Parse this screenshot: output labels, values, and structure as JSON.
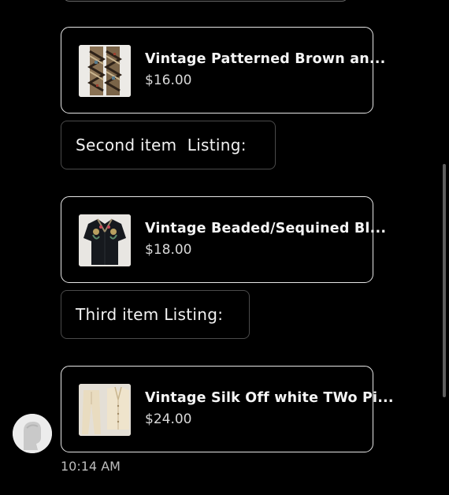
{
  "listings": [
    {
      "title": "Vintage Patterned Brown an...",
      "price": "$16.00",
      "thumb_icon": "patterned-pants-thumbnail"
    },
    {
      "title": "Vintage Beaded/Sequined Bl...",
      "price": "$18.00",
      "thumb_icon": "beaded-shirt-thumbnail"
    },
    {
      "title": "Vintage Silk Off white TWo Pi...",
      "price": "$24.00",
      "thumb_icon": "silk-two-piece-thumbnail"
    }
  ],
  "messages": [
    {
      "text": "Second item  Listing:"
    },
    {
      "text": "Third item Listing:"
    }
  ],
  "timestamp": "10:14 AM",
  "colors": {
    "background": "#000000",
    "card_border": "#e6e6e6",
    "bubble_border": "#4a4a4a",
    "text": "#f2f2f2"
  }
}
